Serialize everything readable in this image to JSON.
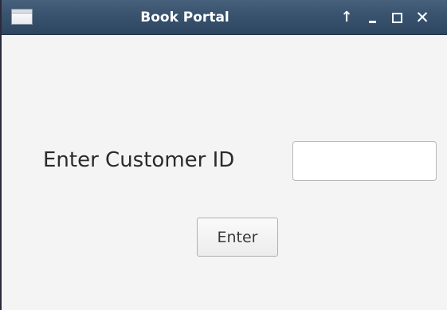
{
  "window": {
    "title": "Book Portal",
    "controls": {
      "pin": "↑",
      "close": "✕"
    }
  },
  "form": {
    "label": "Enter Customer ID",
    "input_value": "",
    "button_label": "Enter"
  },
  "colors": {
    "titlebar": "#3a5470",
    "background": "#f4f4f4",
    "text": "#2b2b2b"
  },
  "icons": [
    "window-icon",
    "pin-icon",
    "minimize-icon",
    "maximize-icon",
    "close-icon"
  ]
}
